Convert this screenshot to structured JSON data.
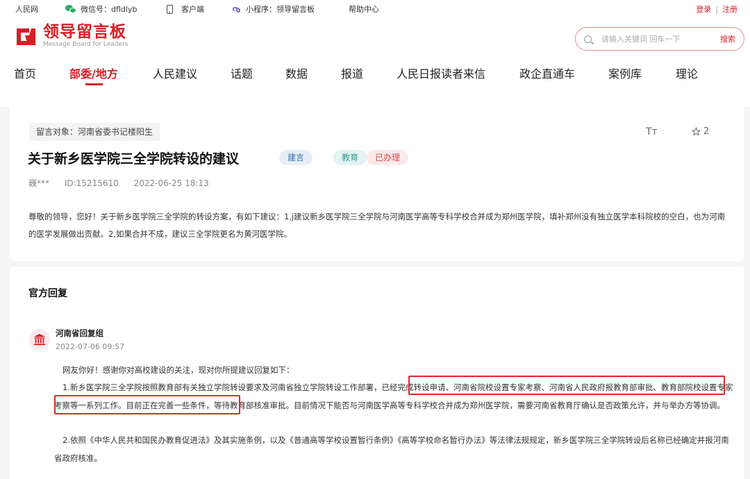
{
  "topbar": {
    "site": "人民网",
    "wechat": "微信号：dfldlyb",
    "client": "客户端",
    "miniprogram": "小程序：领导留言板",
    "help": "帮助中心",
    "login": "登录",
    "separator": "|",
    "register": "注册"
  },
  "logo": {
    "name": "领导留言板",
    "subtitle": "Message Board for Leaders"
  },
  "search": {
    "placeholder": "请输入关键词 回车一下",
    "button": "搜索"
  },
  "nav": [
    "首页",
    "部委/地方",
    "人民建议",
    "话题",
    "数据",
    "报道",
    "人民日报读者来信",
    "政企直通车",
    "案例库",
    "理论"
  ],
  "message": {
    "target": "留言对象：河南省委书记楼阳生",
    "font_icon": "Tт",
    "star_count": "2",
    "title": "关于新乡医学院三全学院转设的建议",
    "tags": [
      "建言",
      "教育",
      "已办理"
    ],
    "author": "巍***",
    "id": "ID:15215610",
    "date": "2022-06-25 18:13",
    "body": "尊敬的领导，您好！关于新乡医学院三全学院的转设方案，有如下建议：1,j建议新乡医学院三全学院与河南医学高等专科学校合并成为郑州医学院，填补郑州没有独立医学本科院校的空白，也为河南的医学发展做出贡献。2,如果合并不成，建议三全学院更名为黄河医学院。"
  },
  "reply": {
    "heading": "官方回复",
    "org": "河南省回复组",
    "date": "2022-07-06 09:57",
    "greeting": "网友你好！感谢你对高校建设的关注，现对你所提建议回复如下：",
    "p1": "1.新乡医学院三全学院按照教育部有关独立学院转设要求及河南省独立学院转设工作部署，已经完成转设申请、河南省院校设置专家考察、河南省人民政府报教育部审批、教育部院校设置专家考察等一系列工作。目前正在完善一些条件，等待教育部核准审批。目前情况下能否与河南医学高等专科学校合并成为郑州医学院，需要河南省教育厅确认是否政策允许，并与举办方等协调。",
    "p2": "2.依照《中华人民共和国民办教育促进法》及其实施条例，以及《普通高等学校设置暂行条例》《高等学校命名暂行办法》等法律法规规定，新乡医学院三全学院转设后名称已经确定并报河南省政府核准。"
  },
  "colors": {
    "brand_red": "#d61f26",
    "highlight_red": "#e3262c",
    "page_bg": "#f4f5f7"
  }
}
